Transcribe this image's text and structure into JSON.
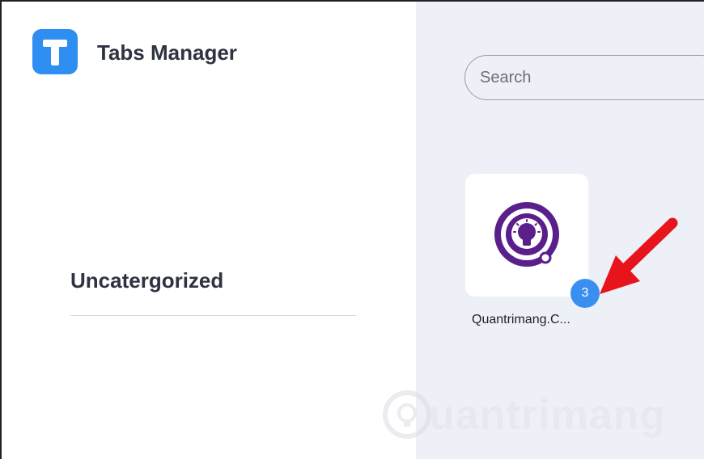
{
  "app": {
    "title": "Tabs Manager",
    "logo_letter": "T",
    "accent_color": "#2f8ef2"
  },
  "sidebar": {
    "group_title": "Uncatergorized"
  },
  "search": {
    "placeholder": "Search"
  },
  "cards": [
    {
      "label": "Quantrimang.C...",
      "badge_count": "3",
      "icon": "lightbulb-icon",
      "icon_color": "#5b1f8c"
    }
  ],
  "annotation": {
    "arrow_color": "#e8141b",
    "icon": "red-arrow-icon"
  },
  "watermark": {
    "text": "uantrimang",
    "icon": "lightbulb-icon"
  },
  "colors": {
    "main_bg": "#eef0f8",
    "badge_bg": "#3a8ef0"
  }
}
